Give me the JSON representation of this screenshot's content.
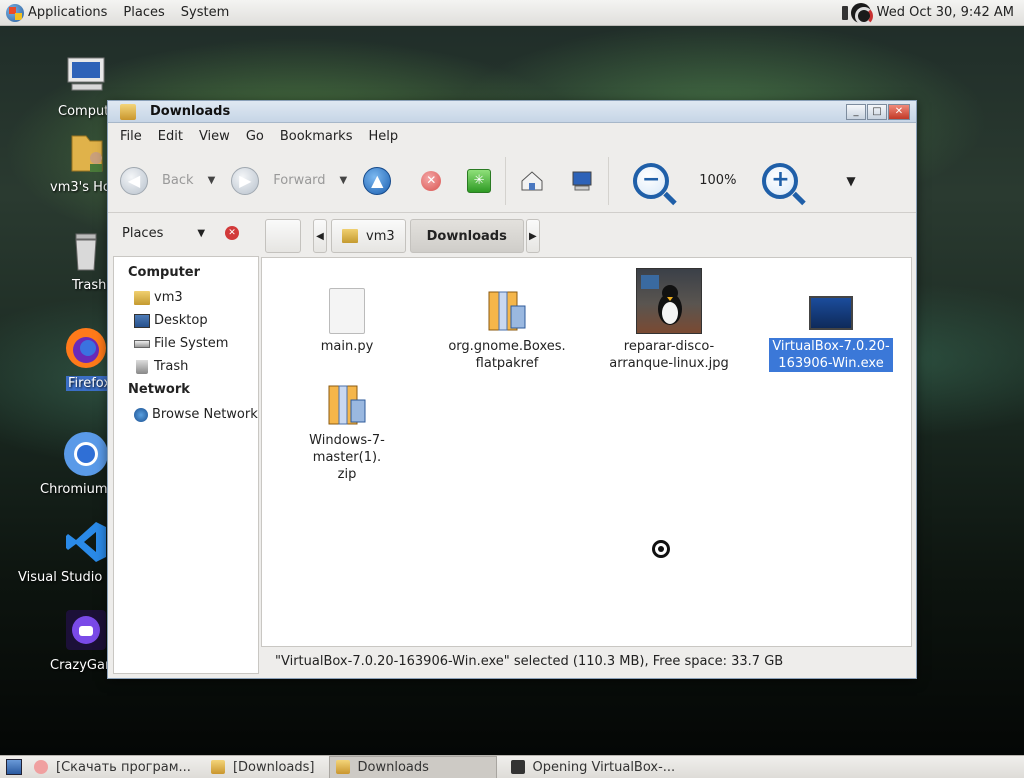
{
  "top_panel": {
    "menus": [
      "Applications",
      "Places",
      "System"
    ],
    "clock": "Wed Oct 30,  9:42 AM"
  },
  "desktop_icons": [
    {
      "label": "Computer",
      "name": "computer"
    },
    {
      "label": "vm3's Home",
      "name": "home"
    },
    {
      "label": "Trash",
      "name": "trash"
    },
    {
      "label": "Firefox",
      "name": "firefox"
    },
    {
      "label": "Chromium",
      "name": "chromium"
    },
    {
      "label": "Visual Studio Code",
      "name": "vscode"
    },
    {
      "label": "CrazyGames",
      "name": "crazygames"
    }
  ],
  "window": {
    "title": "Downloads",
    "menu": [
      "File",
      "Edit",
      "View",
      "Go",
      "Bookmarks",
      "Help"
    ],
    "toolbar": {
      "back": "Back",
      "forward": "Forward",
      "zoom_level": "100%"
    },
    "places_label": "Places",
    "sidebar": {
      "computer_heading": "Computer",
      "computer_items": [
        "vm3",
        "Desktop",
        "File System",
        "Trash"
      ],
      "network_heading": "Network",
      "network_items": [
        "Browse Network"
      ]
    },
    "path": [
      "vm3",
      "Downloads"
    ],
    "files": [
      {
        "name": "main.py",
        "type": "text"
      },
      {
        "name": "org.gnome.Boxes.\nflatpakref",
        "type": "archive"
      },
      {
        "name": "reparar-disco-\narranque-linux.jpg",
        "type": "image"
      },
      {
        "name": "VirtualBox-7.0.20-\n163906-Win.exe",
        "type": "executable",
        "selected": true
      },
      {
        "name": "Windows-7-master(1).\nzip",
        "type": "archive"
      }
    ],
    "status": "\"VirtualBox-7.0.20-163906-Win.exe\" selected (110.3 MB), Free space: 33.7 GB"
  },
  "taskbar": [
    {
      "label": "[Скачать програм...",
      "active": false
    },
    {
      "label": "[Downloads]",
      "active": false
    },
    {
      "label": "Downloads",
      "active": true
    },
    {
      "label": "Opening VirtualBox-...",
      "active": false
    }
  ]
}
